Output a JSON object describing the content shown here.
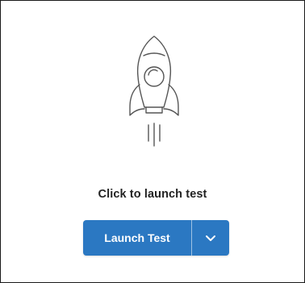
{
  "prompt_text": "Click to launch test",
  "launch_button": {
    "label": "Launch Test",
    "dropdown_icon": "chevron-down-icon"
  },
  "colors": {
    "button_bg": "#2b78c2",
    "rocket_stroke": "#555555",
    "border": "#1a1a1a"
  },
  "illustration_icon": "rocket-icon"
}
